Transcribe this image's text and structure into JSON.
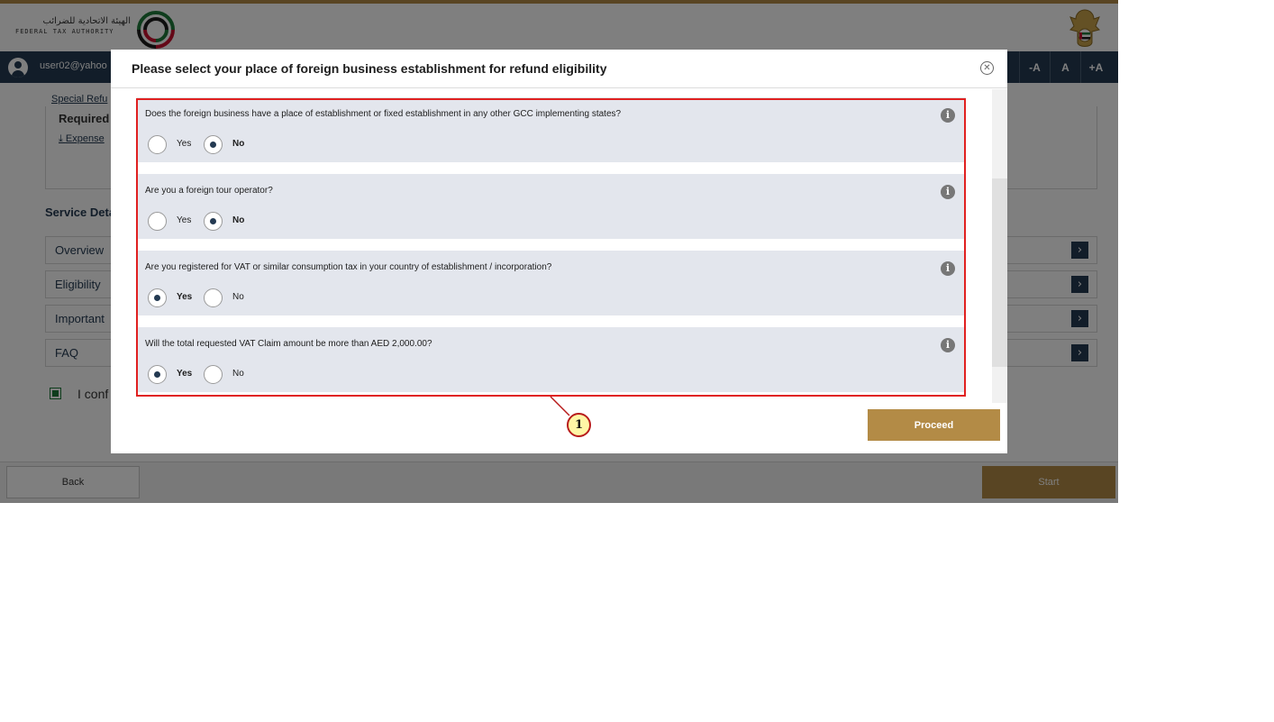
{
  "header": {
    "logo_arabic": "الهيئة الاتحادية للضرائب",
    "logo_english": "FEDERAL TAX AUTHORITY"
  },
  "userbar": {
    "email": "user02@yahoo",
    "font_buttons": [
      "-A",
      "A",
      "+A"
    ]
  },
  "page": {
    "breadcrumb": "Special Refu",
    "required_title": "Required",
    "required_link": "Expense",
    "service_title": "Service Deta",
    "accordion": [
      {
        "label": "Overview"
      },
      {
        "label": "Eligibility"
      },
      {
        "label": "Important"
      },
      {
        "label": "FAQ"
      }
    ],
    "confirm_text": "I conf",
    "back_label": "Back",
    "start_label": "Start"
  },
  "modal": {
    "title": "Please select your place of foreign business establishment for refund eligibility",
    "proceed_label": "Proceed",
    "questions": [
      {
        "text": "Does the foreign business have a place of establishment or fixed establishment in any other GCC implementing states?",
        "yes_label": "Yes",
        "no_label": "No",
        "selected": "No"
      },
      {
        "text": "Are you a foreign tour operator?",
        "yes_label": "Yes",
        "no_label": "No",
        "selected": "No"
      },
      {
        "text": "Are you registered for VAT or similar consumption tax in your country of establishment / incorporation?",
        "yes_label": "Yes",
        "no_label": "No",
        "selected": "Yes"
      },
      {
        "text": "Will the total requested VAT Claim amount be more than AED 2,000.00?",
        "yes_label": "Yes",
        "no_label": "No",
        "selected": "Yes"
      }
    ]
  },
  "annotation": {
    "badge": "1",
    "highlight_color": "#e02020"
  },
  "colors": {
    "brand_gold": "#b38b46",
    "navy": "#243a52",
    "question_bg": "#e3e6ed"
  }
}
